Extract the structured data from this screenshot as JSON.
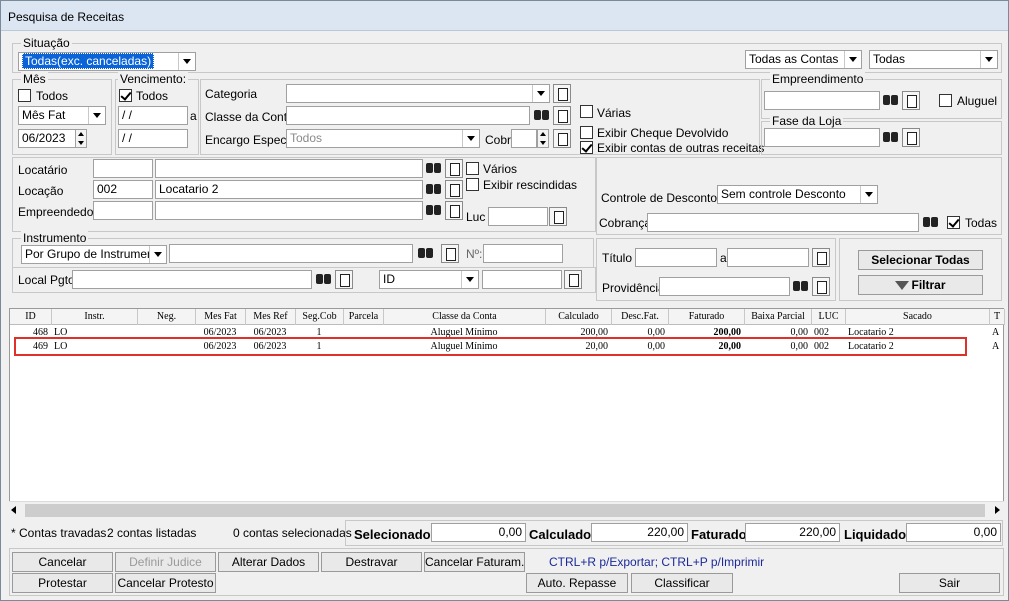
{
  "window": {
    "title": "Pesquisa de Receitas"
  },
  "situacao": {
    "legend": "Situação",
    "value": "Todas(exc. canceladas)"
  },
  "top_right": {
    "contas": "Todas as Contas",
    "todas": "Todas"
  },
  "mes": {
    "legend": "Mês",
    "todos_label": "Todos",
    "todos_checked": false,
    "tipo": "Mês Fat",
    "value": "06/2023"
  },
  "vencimento": {
    "legend": "Vencimento:",
    "todos_label": "Todos",
    "todos_checked": true,
    "date1": " / /",
    "a_label": "a",
    "date2": " / /"
  },
  "categoria": {
    "categoria_label": "Categoria",
    "classe_label": "Classe da Conta",
    "encargo_label": "Encargo Espec.",
    "encargo_value": "Todos",
    "cobr_label": "Cobr"
  },
  "options": {
    "varias": "Várias",
    "cheque": "Exibir Cheque Devolvido",
    "outras": "Exibir contas de outras receitas"
  },
  "empreendimento": {
    "legend": "Empreendimento",
    "aluguel": "Aluguel"
  },
  "fase": {
    "legend": "Fase da Loja"
  },
  "locacao": {
    "locatario_label": "Locatário",
    "locacao_label": "Locação",
    "locacao_code": "002",
    "locacao_name": "Locatario 2",
    "empreendedor_label": "Empreendedor",
    "varios": "Vários",
    "rescindidas": "Exibir rescindidas",
    "luc_label": "Luc"
  },
  "controle": {
    "label": "Controle de Descontos",
    "value": "Sem controle Desconto",
    "cobranca_label": "Cobrança",
    "todas": "Todas"
  },
  "instrumento": {
    "legend": "Instrumento",
    "value": "Por Grupo de Instrumento",
    "no_label": "Nº:"
  },
  "local_pgto": {
    "label": "Local Pgto",
    "id_value": "ID"
  },
  "titulo": {
    "label": "Título",
    "a_label": "a",
    "providencia_label": "Providência"
  },
  "buttons_right": {
    "selecionar": "Selecionar Todas",
    "filtrar": "Filtrar"
  },
  "grid": {
    "columns": [
      "ID",
      "Instr.",
      "Neg.",
      "Mes Fat",
      "Mes Ref",
      "Seg.Cob",
      "Parcela",
      "Classe da Conta",
      "Calculado",
      "Desc.Fat.",
      "Faturado",
      "Baixa Parcial",
      "LUC",
      "Sacado",
      "T"
    ],
    "rows": [
      [
        "468",
        "LO",
        "",
        "06/2023",
        "06/2023",
        "1",
        "",
        "Aluguel Mínimo",
        "200,00",
        "0,00",
        "200,00",
        "0,00",
        "002",
        "Locatario 2",
        "A"
      ],
      [
        "469",
        "LO",
        "",
        "06/2023",
        "06/2023",
        "1",
        "",
        "Aluguel Mínimo",
        "20,00",
        "0,00",
        "20,00",
        "0,00",
        "002",
        "Locatario 2",
        "A"
      ]
    ]
  },
  "summary": {
    "travadas": "* Contas travadas",
    "listadas": "2 contas listadas",
    "selecionadas": "0 contas selecionadas",
    "selecionado_label": "Selecionado",
    "selecionado_value": "0,00",
    "calculado_label": "Calculado",
    "calculado_value": "220,00",
    "faturado_label": "Faturado",
    "faturado_value": "220,00",
    "liquidado_label": "Liquidado",
    "liquidado_value": "0,00"
  },
  "bottom": {
    "cancelar": "Cancelar",
    "definir": "Definir Judice",
    "alterar": "Alterar Dados",
    "destravar": "Destravar",
    "cancelar_fat": "Cancelar Faturam.",
    "hint": "CTRL+R p/Exportar; CTRL+P p/Imprimir",
    "protestar": "Protestar",
    "cancelar_protesto": "Cancelar Protesto",
    "auto_repasse": "Auto. Repasse",
    "classificar": "Classificar",
    "sair": "Sair"
  },
  "colors": {
    "selection": "#0a64d8",
    "highlight_box": "#e0302a",
    "hint_text": "#1a2a9a"
  }
}
